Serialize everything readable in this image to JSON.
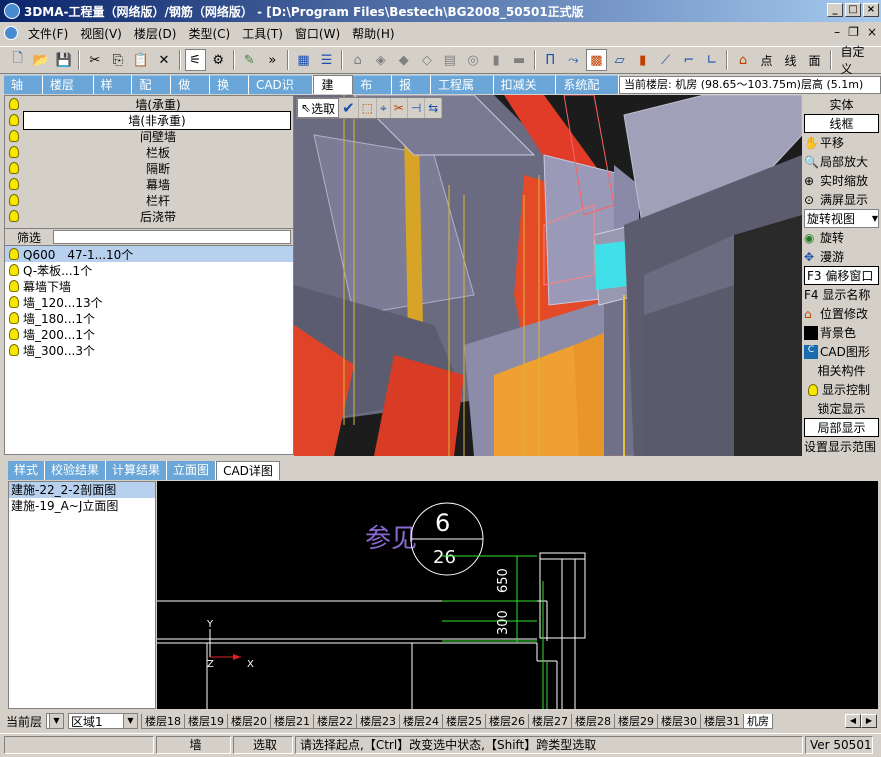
{
  "window": {
    "title": "3DMA-工程量（网络版）/钢筋（网络版） - [D:\\Program Files\\Bestech\\BG2008_50501正式版"
  },
  "menu": [
    "文件(F)",
    "视图(V)",
    "楼层(D)",
    "类型(C)",
    "工具(T)",
    "窗口(W)",
    "帮助(H)"
  ],
  "toolbar": {
    "labels": [
      "点",
      "线",
      "面"
    ],
    "custom": "自定义"
  },
  "tabs": [
    "轴网",
    "楼层表",
    "样式",
    "配筋",
    "做法",
    "换算",
    "CAD识别",
    "建模",
    "布筋",
    "报表",
    "工程属性",
    "扣减关系",
    "系统配置"
  ],
  "active_tab": "建模",
  "floor_info": "当前楼层: 机房 (98.65～103.75m)层高 (5.1m)",
  "types": [
    "墙(承重)",
    "墙(非承重)",
    "间壁墙",
    "栏板",
    "隔断",
    "幕墙",
    "栏杆",
    "后浇带"
  ],
  "filter": {
    "label": "筛选",
    "value": ""
  },
  "components": [
    "Q600　47-1...10个",
    "Q-苯板...1个",
    "幕墙下墙",
    "墙_120...13个",
    "墙_180...1个",
    "墙_200...1个",
    "墙_300...3个"
  ],
  "view_tools": {
    "select": "选取"
  },
  "right_panel": {
    "items": [
      "实体",
      "线框",
      "平移",
      "局部放大",
      "实时缩放",
      "满屏显示",
      "旋转视图",
      "旋转",
      "漫游",
      "F3 偏移窗口",
      "F4 显示名称",
      "位置修改",
      "背景色",
      "CAD图形",
      "相关构件",
      "显示控制",
      "锁定显示",
      "局部显示",
      "设置显示范围"
    ]
  },
  "bottom_tabs": [
    "样式",
    "校验结果",
    "计算结果",
    "立面图",
    "CAD详图"
  ],
  "active_bottom_tab": "CAD详图",
  "drawings": [
    "建施-22_2-2剖面图",
    "建施-19_A~J立面图"
  ],
  "cad": {
    "text1": "参见",
    "circle_top": "6",
    "circle_bottom": "26",
    "dim1": "650",
    "dim2": "300",
    "axis_y": "Y",
    "axis_x": "X",
    "axis_z": "Z"
  },
  "bottom": {
    "current_floor": "当前层",
    "region": "区域1"
  },
  "floor_tabs": [
    "楼层18",
    "楼层19",
    "楼层20",
    "楼层21",
    "楼层22",
    "楼层23",
    "楼层24",
    "楼层25",
    "楼层26",
    "楼层27",
    "楼层28",
    "楼层29",
    "楼层30",
    "楼层31",
    "机房"
  ],
  "active_floor_tab": "机房",
  "status": {
    "type": "墙",
    "mode": "选取",
    "hint": "请选择起点,【Ctrl】改变选中状态,【Shift】跨类型选取",
    "version": "Ver 50501"
  }
}
